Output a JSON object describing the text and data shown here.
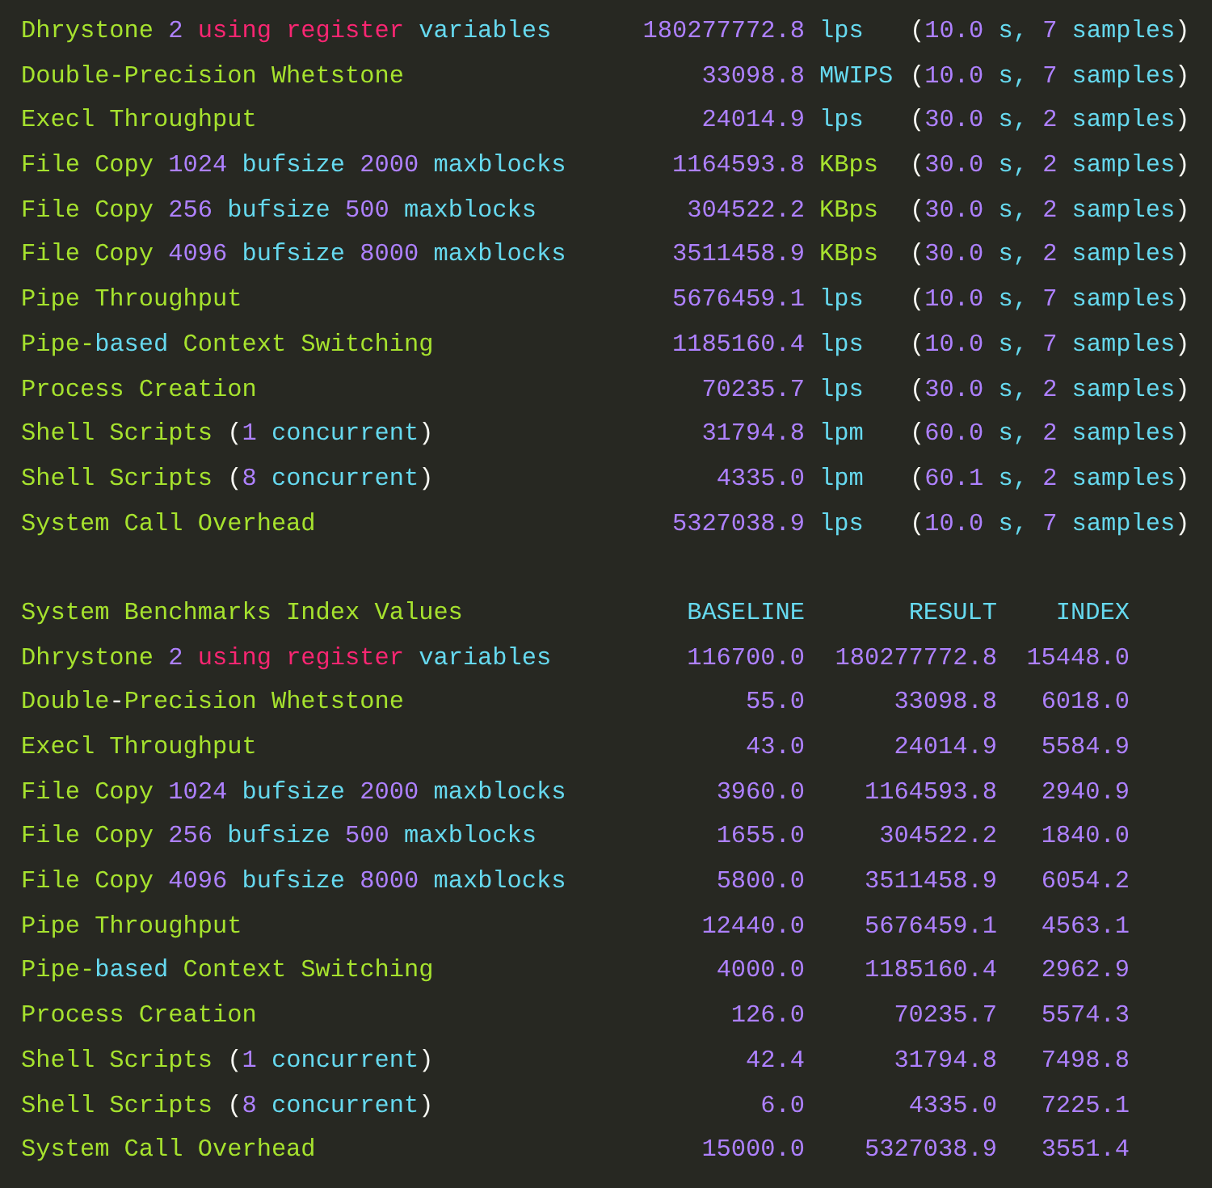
{
  "results": [
    {
      "label": [
        {
          "text": "Dhrystone ",
          "kind": "name"
        },
        {
          "text": "2",
          "kind": "number"
        },
        {
          "text": " using register",
          "kind": "keyword"
        },
        {
          "text": " variables",
          "kind": "word"
        }
      ],
      "value": "180277772.8",
      "unit": {
        "text": "lps",
        "kind": "word"
      },
      "timing": [
        {
          "text": "(",
          "kind": "punct"
        },
        {
          "text": "10.0",
          "kind": "number"
        },
        {
          "text": " s, ",
          "kind": "word"
        },
        {
          "text": "7",
          "kind": "number"
        },
        {
          "text": " samples",
          "kind": "word"
        },
        {
          "text": ")",
          "kind": "punct"
        }
      ]
    },
    {
      "label": [
        {
          "text": "Double-Precision Whetstone",
          "kind": "name"
        }
      ],
      "value": "33098.8",
      "unit": {
        "text": "MWIPS",
        "kind": "word"
      },
      "timing": [
        {
          "text": "(",
          "kind": "punct"
        },
        {
          "text": "10.0",
          "kind": "number"
        },
        {
          "text": " s, ",
          "kind": "word"
        },
        {
          "text": "7",
          "kind": "number"
        },
        {
          "text": " samples",
          "kind": "word"
        },
        {
          "text": ")",
          "kind": "punct"
        }
      ]
    },
    {
      "label": [
        {
          "text": "Execl Throughput",
          "kind": "name"
        }
      ],
      "value": "24014.9",
      "unit": {
        "text": "lps",
        "kind": "word"
      },
      "timing": [
        {
          "text": "(",
          "kind": "punct"
        },
        {
          "text": "30.0",
          "kind": "number"
        },
        {
          "text": " s, ",
          "kind": "word"
        },
        {
          "text": "2",
          "kind": "number"
        },
        {
          "text": " samples",
          "kind": "word"
        },
        {
          "text": ")",
          "kind": "punct"
        }
      ]
    },
    {
      "label": [
        {
          "text": "File Copy ",
          "kind": "name"
        },
        {
          "text": "1024",
          "kind": "number"
        },
        {
          "text": " bufsize ",
          "kind": "word"
        },
        {
          "text": "2000",
          "kind": "number"
        },
        {
          "text": " maxblocks",
          "kind": "word"
        }
      ],
      "value": "1164593.8",
      "unit": {
        "text": "KBps",
        "kind": "name"
      },
      "timing": [
        {
          "text": "(",
          "kind": "punct"
        },
        {
          "text": "30.0",
          "kind": "number"
        },
        {
          "text": " s, ",
          "kind": "word"
        },
        {
          "text": "2",
          "kind": "number"
        },
        {
          "text": " samples",
          "kind": "word"
        },
        {
          "text": ")",
          "kind": "punct"
        }
      ]
    },
    {
      "label": [
        {
          "text": "File Copy ",
          "kind": "name"
        },
        {
          "text": "256",
          "kind": "number"
        },
        {
          "text": " bufsize ",
          "kind": "word"
        },
        {
          "text": "500",
          "kind": "number"
        },
        {
          "text": " maxblocks",
          "kind": "word"
        }
      ],
      "value": "304522.2",
      "unit": {
        "text": "KBps",
        "kind": "name"
      },
      "timing": [
        {
          "text": "(",
          "kind": "punct"
        },
        {
          "text": "30.0",
          "kind": "number"
        },
        {
          "text": " s, ",
          "kind": "word"
        },
        {
          "text": "2",
          "kind": "number"
        },
        {
          "text": " samples",
          "kind": "word"
        },
        {
          "text": ")",
          "kind": "punct"
        }
      ]
    },
    {
      "label": [
        {
          "text": "File Copy ",
          "kind": "name"
        },
        {
          "text": "4096",
          "kind": "number"
        },
        {
          "text": " bufsize ",
          "kind": "word"
        },
        {
          "text": "8000",
          "kind": "number"
        },
        {
          "text": " maxblocks",
          "kind": "word"
        }
      ],
      "value": "3511458.9",
      "unit": {
        "text": "KBps",
        "kind": "name"
      },
      "timing": [
        {
          "text": "(",
          "kind": "punct"
        },
        {
          "text": "30.0",
          "kind": "number"
        },
        {
          "text": " s, ",
          "kind": "word"
        },
        {
          "text": "2",
          "kind": "number"
        },
        {
          "text": " samples",
          "kind": "word"
        },
        {
          "text": ")",
          "kind": "punct"
        }
      ]
    },
    {
      "label": [
        {
          "text": "Pipe Throughput",
          "kind": "name"
        }
      ],
      "value": "5676459.1",
      "unit": {
        "text": "lps",
        "kind": "word"
      },
      "timing": [
        {
          "text": "(",
          "kind": "punct"
        },
        {
          "text": "10.0",
          "kind": "number"
        },
        {
          "text": " s, ",
          "kind": "word"
        },
        {
          "text": "7",
          "kind": "number"
        },
        {
          "text": " samples",
          "kind": "word"
        },
        {
          "text": ")",
          "kind": "punct"
        }
      ]
    },
    {
      "label": [
        {
          "text": "Pipe-",
          "kind": "name"
        },
        {
          "text": "based",
          "kind": "word"
        },
        {
          "text": " Context Switching",
          "kind": "name"
        }
      ],
      "value": "1185160.4",
      "unit": {
        "text": "lps",
        "kind": "word"
      },
      "timing": [
        {
          "text": "(",
          "kind": "punct"
        },
        {
          "text": "10.0",
          "kind": "number"
        },
        {
          "text": " s, ",
          "kind": "word"
        },
        {
          "text": "7",
          "kind": "number"
        },
        {
          "text": " samples",
          "kind": "word"
        },
        {
          "text": ")",
          "kind": "punct"
        }
      ]
    },
    {
      "label": [
        {
          "text": "Process Creation",
          "kind": "name"
        }
      ],
      "value": "70235.7",
      "unit": {
        "text": "lps",
        "kind": "word"
      },
      "timing": [
        {
          "text": "(",
          "kind": "punct"
        },
        {
          "text": "30.0",
          "kind": "number"
        },
        {
          "text": " s, ",
          "kind": "word"
        },
        {
          "text": "2",
          "kind": "number"
        },
        {
          "text": " samples",
          "kind": "word"
        },
        {
          "text": ")",
          "kind": "punct"
        }
      ]
    },
    {
      "label": [
        {
          "text": "Shell Scripts ",
          "kind": "name"
        },
        {
          "text": "(",
          "kind": "punct"
        },
        {
          "text": "1",
          "kind": "number"
        },
        {
          "text": " concurrent",
          "kind": "word"
        },
        {
          "text": ")",
          "kind": "punct"
        }
      ],
      "value": "31794.8",
      "unit": {
        "text": "lpm",
        "kind": "word"
      },
      "timing": [
        {
          "text": "(",
          "kind": "punct"
        },
        {
          "text": "60.0",
          "kind": "number"
        },
        {
          "text": " s, ",
          "kind": "word"
        },
        {
          "text": "2",
          "kind": "number"
        },
        {
          "text": " samples",
          "kind": "word"
        },
        {
          "text": ")",
          "kind": "punct"
        }
      ]
    },
    {
      "label": [
        {
          "text": "Shell Scripts ",
          "kind": "name"
        },
        {
          "text": "(",
          "kind": "punct"
        },
        {
          "text": "8",
          "kind": "number"
        },
        {
          "text": " concurrent",
          "kind": "word"
        },
        {
          "text": ")",
          "kind": "punct"
        }
      ],
      "value": "4335.0",
      "unit": {
        "text": "lpm",
        "kind": "word"
      },
      "timing": [
        {
          "text": "(",
          "kind": "punct"
        },
        {
          "text": "60.1",
          "kind": "number"
        },
        {
          "text": " s, ",
          "kind": "word"
        },
        {
          "text": "2",
          "kind": "number"
        },
        {
          "text": " samples",
          "kind": "word"
        },
        {
          "text": ")",
          "kind": "punct"
        }
      ]
    },
    {
      "label": [
        {
          "text": "System Call Overhead",
          "kind": "name"
        }
      ],
      "value": "5327038.9",
      "unit": {
        "text": "lps",
        "kind": "word"
      },
      "timing": [
        {
          "text": "(",
          "kind": "punct"
        },
        {
          "text": "10.0",
          "kind": "number"
        },
        {
          "text": " s, ",
          "kind": "word"
        },
        {
          "text": "7",
          "kind": "number"
        },
        {
          "text": " samples",
          "kind": "word"
        },
        {
          "text": ")",
          "kind": "punct"
        }
      ]
    }
  ],
  "index_table": {
    "title": "System Benchmarks Index Values",
    "columns": [
      "BASELINE",
      "RESULT",
      "INDEX"
    ],
    "rows": [
      {
        "label": [
          {
            "text": "Dhrystone ",
            "kind": "name"
          },
          {
            "text": "2",
            "kind": "number"
          },
          {
            "text": " using register",
            "kind": "keyword"
          },
          {
            "text": " variables",
            "kind": "word"
          }
        ],
        "baseline": "116700.0",
        "result": "180277772.8",
        "index": "15448.0"
      },
      {
        "label": [
          {
            "text": "Double",
            "kind": "name"
          },
          {
            "text": "-",
            "kind": "punct"
          },
          {
            "text": "Precision Whetstone",
            "kind": "name"
          }
        ],
        "baseline": "55.0",
        "result": "33098.8",
        "index": "6018.0"
      },
      {
        "label": [
          {
            "text": "Execl Throughput",
            "kind": "name"
          }
        ],
        "baseline": "43.0",
        "result": "24014.9",
        "index": "5584.9"
      },
      {
        "label": [
          {
            "text": "File Copy ",
            "kind": "name"
          },
          {
            "text": "1024",
            "kind": "number"
          },
          {
            "text": " bufsize ",
            "kind": "word"
          },
          {
            "text": "2000",
            "kind": "number"
          },
          {
            "text": " maxblocks",
            "kind": "word"
          }
        ],
        "baseline": "3960.0",
        "result": "1164593.8",
        "index": "2940.9"
      },
      {
        "label": [
          {
            "text": "File Copy ",
            "kind": "name"
          },
          {
            "text": "256",
            "kind": "number"
          },
          {
            "text": " bufsize ",
            "kind": "word"
          },
          {
            "text": "500",
            "kind": "number"
          },
          {
            "text": " maxblocks",
            "kind": "word"
          }
        ],
        "baseline": "1655.0",
        "result": "304522.2",
        "index": "1840.0"
      },
      {
        "label": [
          {
            "text": "File Copy ",
            "kind": "name"
          },
          {
            "text": "4096",
            "kind": "number"
          },
          {
            "text": " bufsize ",
            "kind": "word"
          },
          {
            "text": "8000",
            "kind": "number"
          },
          {
            "text": " maxblocks",
            "kind": "word"
          }
        ],
        "baseline": "5800.0",
        "result": "3511458.9",
        "index": "6054.2"
      },
      {
        "label": [
          {
            "text": "Pipe Throughput",
            "kind": "name"
          }
        ],
        "baseline": "12440.0",
        "result": "5676459.1",
        "index": "4563.1"
      },
      {
        "label": [
          {
            "text": "Pipe-",
            "kind": "name"
          },
          {
            "text": "based",
            "kind": "word"
          },
          {
            "text": " Context Switching",
            "kind": "name"
          }
        ],
        "baseline": "4000.0",
        "result": "1185160.4",
        "index": "2962.9"
      },
      {
        "label": [
          {
            "text": "Process Creation",
            "kind": "name"
          }
        ],
        "baseline": "126.0",
        "result": "70235.7",
        "index": "5574.3"
      },
      {
        "label": [
          {
            "text": "Shell Scripts ",
            "kind": "name"
          },
          {
            "text": "(",
            "kind": "punct"
          },
          {
            "text": "1",
            "kind": "number"
          },
          {
            "text": " concurrent",
            "kind": "word"
          },
          {
            "text": ")",
            "kind": "punct"
          }
        ],
        "baseline": "42.4",
        "result": "31794.8",
        "index": "7498.8"
      },
      {
        "label": [
          {
            "text": "Shell Scripts ",
            "kind": "name"
          },
          {
            "text": "(",
            "kind": "punct"
          },
          {
            "text": "8",
            "kind": "number"
          },
          {
            "text": " concurrent",
            "kind": "word"
          },
          {
            "text": ")",
            "kind": "punct"
          }
        ],
        "baseline": "6.0",
        "result": "4335.0",
        "index": "7225.1"
      },
      {
        "label": [
          {
            "text": "System Call Overhead",
            "kind": "name"
          }
        ],
        "baseline": "15000.0",
        "result": "5327038.9",
        "index": "3551.4"
      }
    ]
  }
}
